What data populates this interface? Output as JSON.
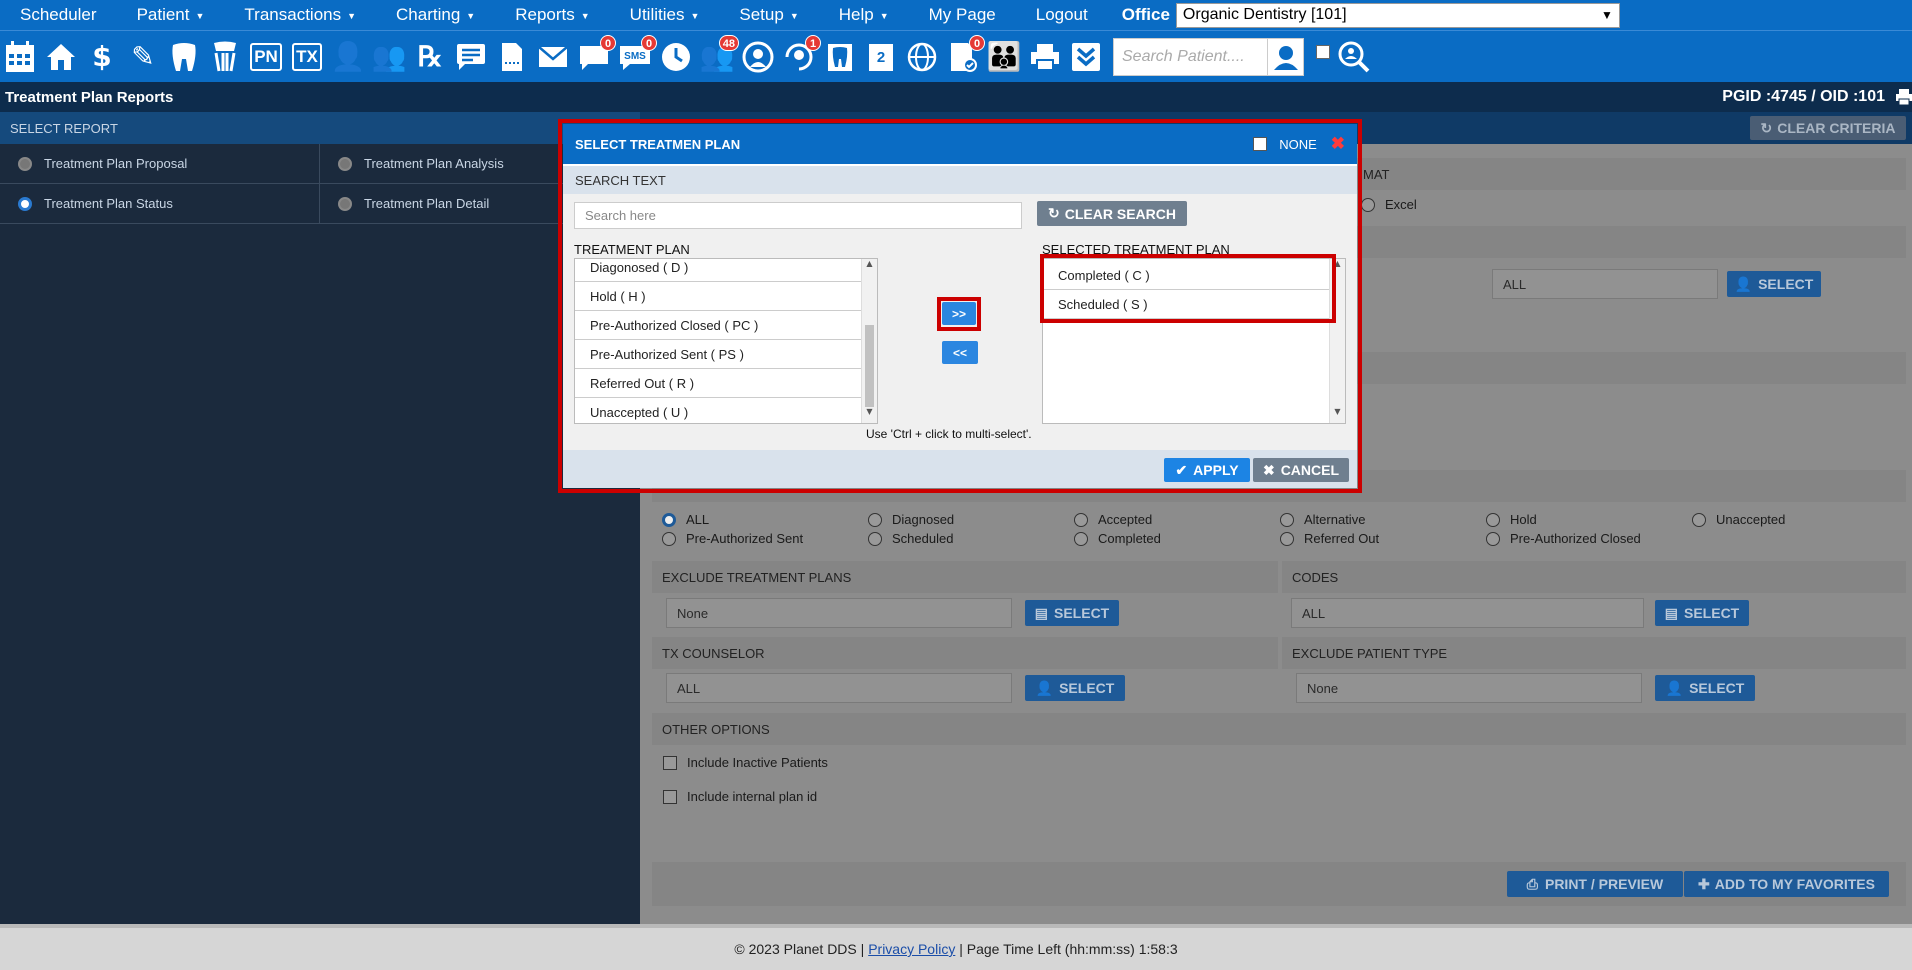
{
  "menu": {
    "items": [
      {
        "label": "Scheduler",
        "caret": false
      },
      {
        "label": "Patient",
        "caret": true
      },
      {
        "label": "Transactions",
        "caret": true
      },
      {
        "label": "Charting",
        "caret": true
      },
      {
        "label": "Reports",
        "caret": true
      },
      {
        "label": "Utilities",
        "caret": true
      },
      {
        "label": "Setup",
        "caret": true
      },
      {
        "label": "Help",
        "caret": true
      },
      {
        "label": "My Page",
        "caret": false
      },
      {
        "label": "Logout",
        "caret": false
      }
    ],
    "office_label": "Office",
    "office_value": "Organic Dentistry [101]"
  },
  "toolbar": {
    "badges": {
      "messages": "0",
      "sms": "0",
      "web": "48",
      "portal": "1",
      "forms": "0"
    },
    "sms_text": "SMS",
    "pn_text": "PN",
    "tx_text": "TX",
    "search_placeholder": "Search Patient...."
  },
  "titlebar": {
    "title": "Treatment Plan Reports",
    "ids": "PGID :4745  /  OID :101"
  },
  "left": {
    "select_report": "SELECT REPORT",
    "reports": [
      {
        "label": "Treatment Plan Proposal",
        "selected": false
      },
      {
        "label": "Treatment Plan Analysis",
        "selected": false
      },
      {
        "label": "Treatment Plan Status",
        "selected": true
      },
      {
        "label": "Treatment Plan Detail",
        "selected": false
      }
    ]
  },
  "right": {
    "clear_criteria": "CLEAR CRITERIA",
    "format_label": "MAT",
    "excel_label": "Excel",
    "all_value": "ALL",
    "select_label": "SELECT",
    "status_options": [
      "ALL",
      "Diagnosed",
      "Accepted",
      "Alternative",
      "Hold",
      "Unaccepted",
      "Pre-Authorized Sent",
      "Scheduled",
      "Completed",
      "Referred Out",
      "Pre-Authorized Closed"
    ],
    "exclude_tp_label": "EXCLUDE TREATMENT PLANS",
    "exclude_tp_value": "None",
    "codes_label": "CODES",
    "codes_value": "ALL",
    "tx_counselor_label": "TX COUNSELOR",
    "tx_counselor_value": "ALL",
    "exclude_pt_label": "EXCLUDE PATIENT TYPE",
    "exclude_pt_value": "None",
    "other_options_label": "OTHER OPTIONS",
    "opt_inactive": "Include Inactive Patients",
    "opt_internal": "Include internal plan id",
    "print_preview": "PRINT / PREVIEW",
    "add_favorites": "ADD TO MY FAVORITES"
  },
  "modal": {
    "title": "SELECT TREATMEN PLAN",
    "none_label": "NONE",
    "search_text_label": "SEARCH TEXT",
    "search_placeholder": "Search here",
    "clear_search": "CLEAR SEARCH",
    "treatment_plan_label": "TREATMENT PLAN",
    "selected_label": "SELECTED TREATMENT PLAN",
    "available": [
      "Diagonosed ( D )",
      "Hold ( H )",
      "Pre-Authorized Closed ( PC )",
      "Pre-Authorized Sent ( PS )",
      "Referred Out ( R )",
      "Unaccepted ( U )"
    ],
    "selected": [
      "Completed ( C )",
      "Scheduled ( S )"
    ],
    "add_btn": ">>",
    "remove_btn": "<<",
    "hint": "Use 'Ctrl + click to multi-select'.",
    "apply": "APPLY",
    "cancel": "CANCEL"
  },
  "footer": {
    "copyright": "© 2023 Planet DDS |",
    "privacy": "Privacy Policy",
    "time_left": "|  Page Time Left (hh:mm:ss) 1:58:3"
  }
}
